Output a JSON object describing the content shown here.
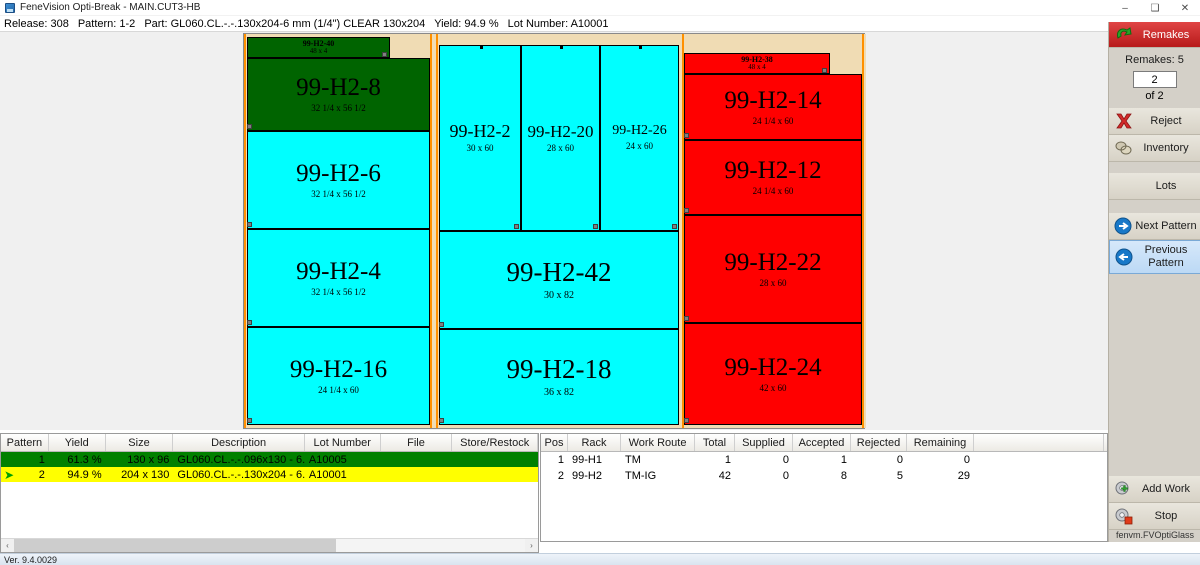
{
  "window": {
    "title": "FeneVision Opti-Break - MAIN.CUT3-HB",
    "minimize": "–",
    "maximize": "❑",
    "close": "✕"
  },
  "infobar": {
    "release_label": "Release: 308",
    "pattern_label": "Pattern: 1-2",
    "part_label": "Part: GL060.CL.-.-.130x204-6 mm (1/4\") CLEAR 130x204",
    "yield_label": "Yield: 94.9 %",
    "lot_label": "Lot Number: A10001"
  },
  "colors": {
    "green_piece": "#006400",
    "cyan_piece": "#00ffff",
    "red_piece": "#ff0000",
    "sheet_background": "#f0dcb4",
    "remakes_button": "#b71a1a",
    "row_green": "#008000",
    "row_yellow": "#ffff00"
  },
  "pattern_diagram": {
    "sections": [
      {
        "name": "left-section",
        "pieces": [
          {
            "id": "99-H2-40",
            "dim": "48 x 4",
            "color": "green",
            "size": "strip"
          },
          {
            "id": "99-H2-8",
            "dim": "32 1/4 x 56 1/2",
            "color": "green",
            "size": "large"
          },
          {
            "id": "99-H2-6",
            "dim": "32 1/4 x 56 1/2",
            "color": "cyan",
            "size": "large"
          },
          {
            "id": "99-H2-4",
            "dim": "32 1/4 x 56 1/2",
            "color": "cyan",
            "size": "large"
          },
          {
            "id": "99-H2-16",
            "dim": "24 1/4 x 60",
            "color": "cyan",
            "size": "large"
          }
        ]
      },
      {
        "name": "middle-section",
        "pieces": [
          {
            "id": "99-H2-2",
            "dim": "30 x 60",
            "color": "cyan",
            "size": "medium"
          },
          {
            "id": "99-H2-20",
            "dim": "28 x 60",
            "color": "cyan",
            "size": "medium"
          },
          {
            "id": "99-H2-26",
            "dim": "24 x 60",
            "color": "cyan",
            "size": "medium"
          },
          {
            "id": "99-H2-42",
            "dim": "30 x 82",
            "color": "cyan",
            "size": "large"
          },
          {
            "id": "99-H2-18",
            "dim": "36 x 82",
            "color": "cyan",
            "size": "large"
          }
        ]
      },
      {
        "name": "right-section",
        "pieces": [
          {
            "id": "99-H2-38",
            "dim": "48 x 4",
            "color": "red",
            "size": "strip"
          },
          {
            "id": "99-H2-14",
            "dim": "24 1/4 x 60",
            "color": "red",
            "size": "large"
          },
          {
            "id": "99-H2-12",
            "dim": "24 1/4 x 60",
            "color": "red",
            "size": "large"
          },
          {
            "id": "99-H2-22",
            "dim": "28 x 60",
            "color": "red",
            "size": "large"
          },
          {
            "id": "99-H2-24",
            "dim": "42 x 60",
            "color": "red",
            "size": "large"
          }
        ]
      }
    ]
  },
  "command_panel": {
    "remakes_button": "Remakes",
    "remakes_count": "Remakes: 5",
    "counter_value": "2",
    "counter_of": "of 2",
    "reject_button": "Reject",
    "inventory_button": "Inventory",
    "lots_button": "Lots",
    "next_pattern_button": "Next Pattern",
    "previous_pattern_button": "Previous\nPattern",
    "previous_pattern_line1": "Previous",
    "previous_pattern_line2": "Pattern",
    "add_work_button": "Add Work",
    "stop_button": "Stop",
    "footer": "fenvm.FVOptiGlass"
  },
  "pattern_grid": {
    "columns": [
      "Pattern",
      "Yield",
      "Size",
      "Description",
      "Lot Number",
      "File",
      "Store/Restock"
    ],
    "rows": [
      {
        "selected": false,
        "pattern": "1",
        "yield": "61.3 %",
        "size": "130 x 96",
        "description": "GL060.CL.-.-.096x130  -  6...",
        "lot_number": "A10005",
        "file": "",
        "store_restock": ""
      },
      {
        "selected": true,
        "pattern": "2",
        "yield": "94.9 %",
        "size": "204 x 130",
        "description": "GL060.CL.-.-.130x204  -  6...",
        "lot_number": "A10001",
        "file": "",
        "store_restock": ""
      }
    ]
  },
  "rack_grid": {
    "columns": [
      "Pos",
      "Rack",
      "Work Route",
      "Total",
      "Supplied",
      "Accepted",
      "Rejected",
      "Remaining"
    ],
    "rows": [
      {
        "pos": "1",
        "rack": "99-H1",
        "work_route": "TM",
        "total": "1",
        "supplied": "0",
        "accepted": "1",
        "rejected": "0",
        "remaining": "0"
      },
      {
        "pos": "2",
        "rack": "99-H2",
        "work_route": "TM-IG",
        "total": "42",
        "supplied": "0",
        "accepted": "8",
        "rejected": "5",
        "remaining": "29"
      }
    ]
  },
  "scrollbar": {
    "left_arrow": "‹",
    "right_arrow": "›"
  },
  "statusbar": {
    "version": "Ver. 9.4.0029"
  }
}
